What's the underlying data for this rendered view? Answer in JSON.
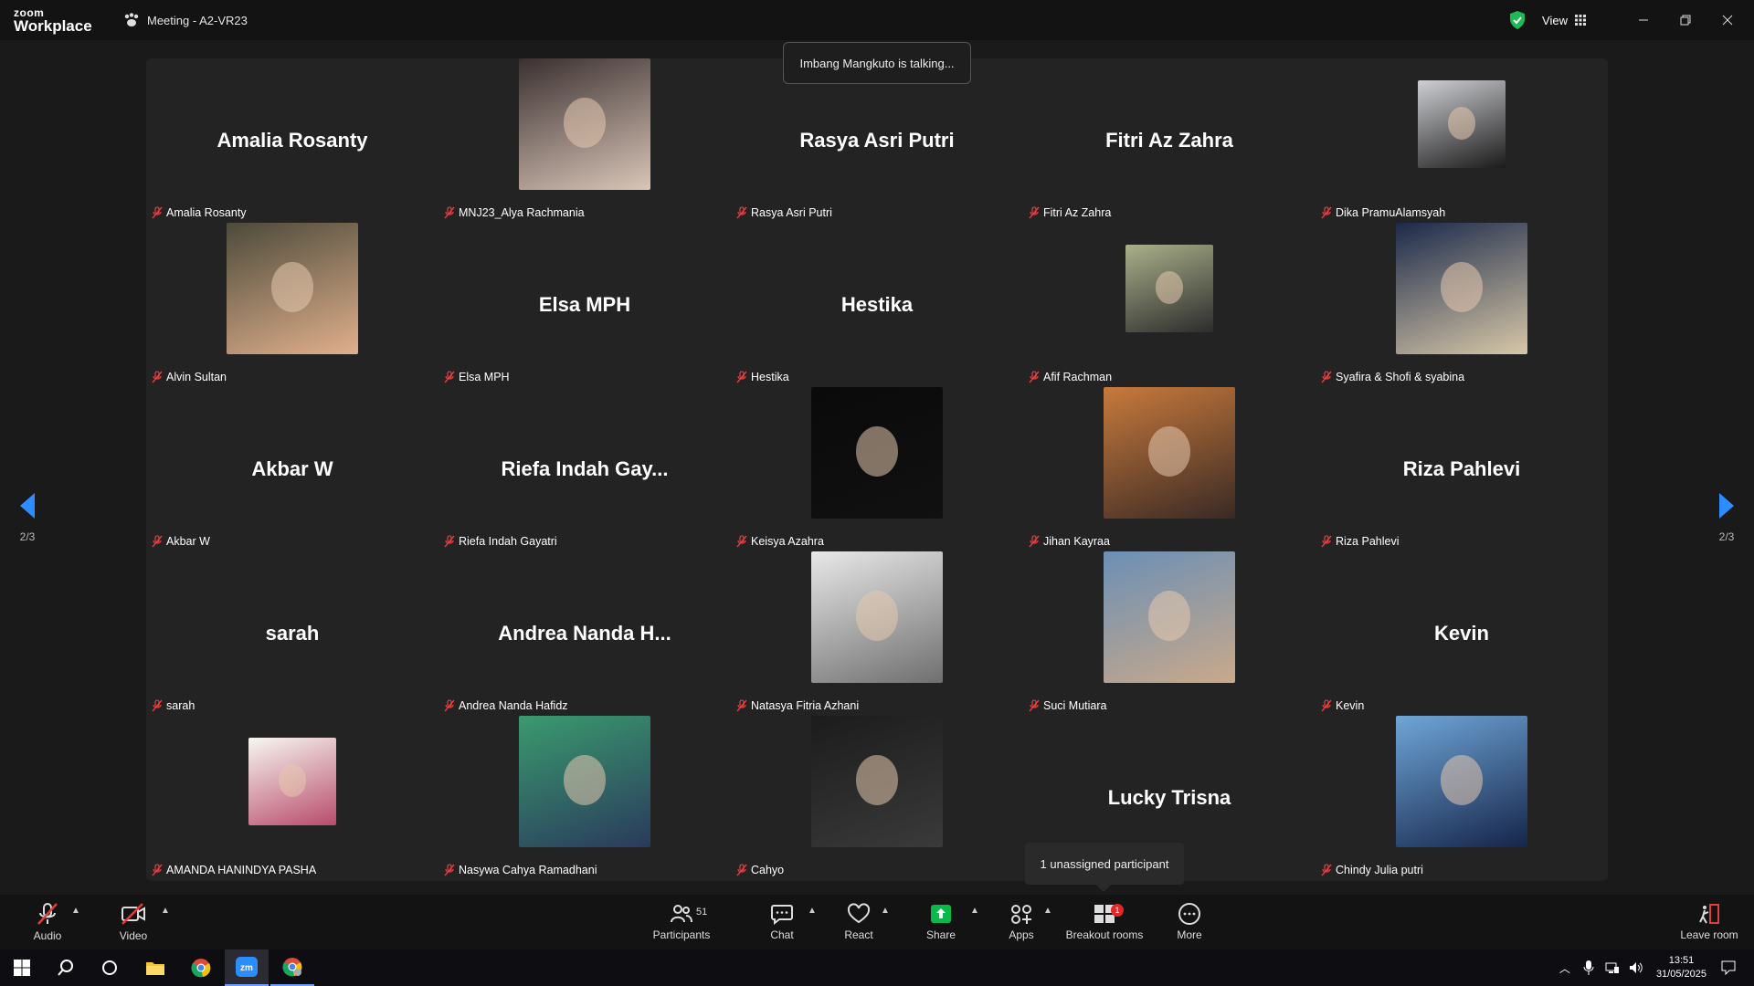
{
  "window": {
    "logo_top": "zoom",
    "logo_bottom": "Workplace",
    "title": "Meeting - A2-VR23",
    "view_label": "View"
  },
  "speaking_banner": "Imbang Mangkuto is talking...",
  "pagination": {
    "left": "2/3",
    "right": "2/3"
  },
  "participants": [
    {
      "display": "Amalia Rosanty",
      "label": "Amalia Rosanty",
      "video": false
    },
    {
      "display": "",
      "label": "MNJ23_Alya Rachmania",
      "video": true
    },
    {
      "display": "Rasya Asri Putri",
      "label": "Rasya Asri Putri",
      "video": false
    },
    {
      "display": "Fitri Az Zahra",
      "label": "Fitri Az Zahra",
      "video": false
    },
    {
      "display": "",
      "label": "Dika PramuAlamsyah",
      "video": true
    },
    {
      "display": "",
      "label": "Alvin Sultan",
      "video": true
    },
    {
      "display": "Elsa MPH",
      "label": "Elsa MPH",
      "video": false
    },
    {
      "display": "Hestika",
      "label": "Hestika",
      "video": false
    },
    {
      "display": "",
      "label": "Afif Rachman",
      "video": true
    },
    {
      "display": "",
      "label": "Syafira & Shofi & syabina",
      "video": true
    },
    {
      "display": "Akbar W",
      "label": "Akbar W",
      "video": false
    },
    {
      "display": "Riefa Indah Gay...",
      "label": "Riefa Indah Gayatri",
      "video": false
    },
    {
      "display": "",
      "label": "Keisya Azahra",
      "video": true
    },
    {
      "display": "",
      "label": "Jihan Kayraa",
      "video": true
    },
    {
      "display": "Riza Pahlevi",
      "label": "Riza Pahlevi",
      "video": false
    },
    {
      "display": "sarah",
      "label": "sarah",
      "video": false
    },
    {
      "display": "Andrea Nanda H...",
      "label": "Andrea Nanda Hafidz",
      "video": false
    },
    {
      "display": "",
      "label": "Natasya Fitria Azhani",
      "video": true
    },
    {
      "display": "",
      "label": "Suci Mutiara",
      "video": true
    },
    {
      "display": "Kevin",
      "label": "Kevin",
      "video": false
    },
    {
      "display": "",
      "label": "AMANDA HANINDYA PASHA",
      "video": true
    },
    {
      "display": "",
      "label": "Nasywa Cahya Ramadhani",
      "video": true
    },
    {
      "display": "",
      "label": "Cahyo",
      "video": true
    },
    {
      "display": "Lucky Trisna",
      "label": "",
      "video": false
    },
    {
      "display": "",
      "label": "Chindy Julia putri",
      "video": true
    }
  ],
  "unassigned_tooltip": "1 unassigned participant",
  "toolbar": {
    "audio": "Audio",
    "video": "Video",
    "participants": "Participants",
    "participants_count": "51",
    "chat": "Chat",
    "react": "React",
    "share": "Share",
    "apps": "Apps",
    "breakout": "Breakout rooms",
    "breakout_badge": "1",
    "more": "More",
    "leave": "Leave room"
  },
  "taskbar": {
    "time": "13:51",
    "date": "31/05/2025"
  },
  "colors": {
    "share_green": "#0bb94a",
    "accent_blue": "#2d8cff",
    "mute_red": "#e03e3e",
    "badge_red": "#e02828"
  }
}
